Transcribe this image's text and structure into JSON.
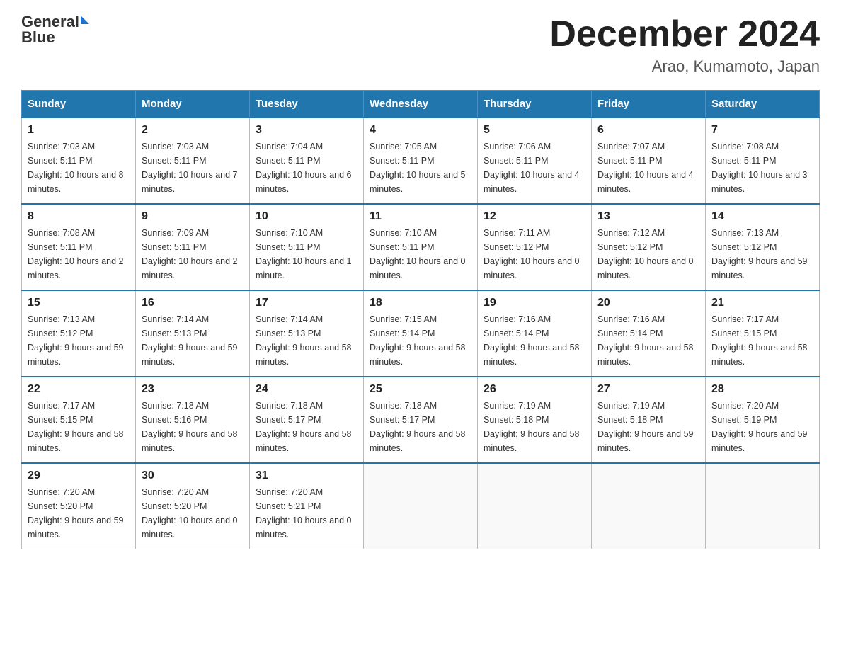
{
  "header": {
    "logo_general": "General",
    "logo_blue": "Blue",
    "month_title": "December 2024",
    "location": "Arao, Kumamoto, Japan"
  },
  "days_of_week": [
    "Sunday",
    "Monday",
    "Tuesday",
    "Wednesday",
    "Thursday",
    "Friday",
    "Saturday"
  ],
  "weeks": [
    [
      {
        "day": "1",
        "sunrise": "7:03 AM",
        "sunset": "5:11 PM",
        "daylight": "10 hours and 8 minutes."
      },
      {
        "day": "2",
        "sunrise": "7:03 AM",
        "sunset": "5:11 PM",
        "daylight": "10 hours and 7 minutes."
      },
      {
        "day": "3",
        "sunrise": "7:04 AM",
        "sunset": "5:11 PM",
        "daylight": "10 hours and 6 minutes."
      },
      {
        "day": "4",
        "sunrise": "7:05 AM",
        "sunset": "5:11 PM",
        "daylight": "10 hours and 5 minutes."
      },
      {
        "day": "5",
        "sunrise": "7:06 AM",
        "sunset": "5:11 PM",
        "daylight": "10 hours and 4 minutes."
      },
      {
        "day": "6",
        "sunrise": "7:07 AM",
        "sunset": "5:11 PM",
        "daylight": "10 hours and 4 minutes."
      },
      {
        "day": "7",
        "sunrise": "7:08 AM",
        "sunset": "5:11 PM",
        "daylight": "10 hours and 3 minutes."
      }
    ],
    [
      {
        "day": "8",
        "sunrise": "7:08 AM",
        "sunset": "5:11 PM",
        "daylight": "10 hours and 2 minutes."
      },
      {
        "day": "9",
        "sunrise": "7:09 AM",
        "sunset": "5:11 PM",
        "daylight": "10 hours and 2 minutes."
      },
      {
        "day": "10",
        "sunrise": "7:10 AM",
        "sunset": "5:11 PM",
        "daylight": "10 hours and 1 minute."
      },
      {
        "day": "11",
        "sunrise": "7:10 AM",
        "sunset": "5:11 PM",
        "daylight": "10 hours and 0 minutes."
      },
      {
        "day": "12",
        "sunrise": "7:11 AM",
        "sunset": "5:12 PM",
        "daylight": "10 hours and 0 minutes."
      },
      {
        "day": "13",
        "sunrise": "7:12 AM",
        "sunset": "5:12 PM",
        "daylight": "10 hours and 0 minutes."
      },
      {
        "day": "14",
        "sunrise": "7:13 AM",
        "sunset": "5:12 PM",
        "daylight": "9 hours and 59 minutes."
      }
    ],
    [
      {
        "day": "15",
        "sunrise": "7:13 AM",
        "sunset": "5:12 PM",
        "daylight": "9 hours and 59 minutes."
      },
      {
        "day": "16",
        "sunrise": "7:14 AM",
        "sunset": "5:13 PM",
        "daylight": "9 hours and 59 minutes."
      },
      {
        "day": "17",
        "sunrise": "7:14 AM",
        "sunset": "5:13 PM",
        "daylight": "9 hours and 58 minutes."
      },
      {
        "day": "18",
        "sunrise": "7:15 AM",
        "sunset": "5:14 PM",
        "daylight": "9 hours and 58 minutes."
      },
      {
        "day": "19",
        "sunrise": "7:16 AM",
        "sunset": "5:14 PM",
        "daylight": "9 hours and 58 minutes."
      },
      {
        "day": "20",
        "sunrise": "7:16 AM",
        "sunset": "5:14 PM",
        "daylight": "9 hours and 58 minutes."
      },
      {
        "day": "21",
        "sunrise": "7:17 AM",
        "sunset": "5:15 PM",
        "daylight": "9 hours and 58 minutes."
      }
    ],
    [
      {
        "day": "22",
        "sunrise": "7:17 AM",
        "sunset": "5:15 PM",
        "daylight": "9 hours and 58 minutes."
      },
      {
        "day": "23",
        "sunrise": "7:18 AM",
        "sunset": "5:16 PM",
        "daylight": "9 hours and 58 minutes."
      },
      {
        "day": "24",
        "sunrise": "7:18 AM",
        "sunset": "5:17 PM",
        "daylight": "9 hours and 58 minutes."
      },
      {
        "day": "25",
        "sunrise": "7:18 AM",
        "sunset": "5:17 PM",
        "daylight": "9 hours and 58 minutes."
      },
      {
        "day": "26",
        "sunrise": "7:19 AM",
        "sunset": "5:18 PM",
        "daylight": "9 hours and 58 minutes."
      },
      {
        "day": "27",
        "sunrise": "7:19 AM",
        "sunset": "5:18 PM",
        "daylight": "9 hours and 59 minutes."
      },
      {
        "day": "28",
        "sunrise": "7:20 AM",
        "sunset": "5:19 PM",
        "daylight": "9 hours and 59 minutes."
      }
    ],
    [
      {
        "day": "29",
        "sunrise": "7:20 AM",
        "sunset": "5:20 PM",
        "daylight": "9 hours and 59 minutes."
      },
      {
        "day": "30",
        "sunrise": "7:20 AM",
        "sunset": "5:20 PM",
        "daylight": "10 hours and 0 minutes."
      },
      {
        "day": "31",
        "sunrise": "7:20 AM",
        "sunset": "5:21 PM",
        "daylight": "10 hours and 0 minutes."
      },
      null,
      null,
      null,
      null
    ]
  ],
  "labels": {
    "sunrise": "Sunrise:",
    "sunset": "Sunset:",
    "daylight": "Daylight:"
  }
}
